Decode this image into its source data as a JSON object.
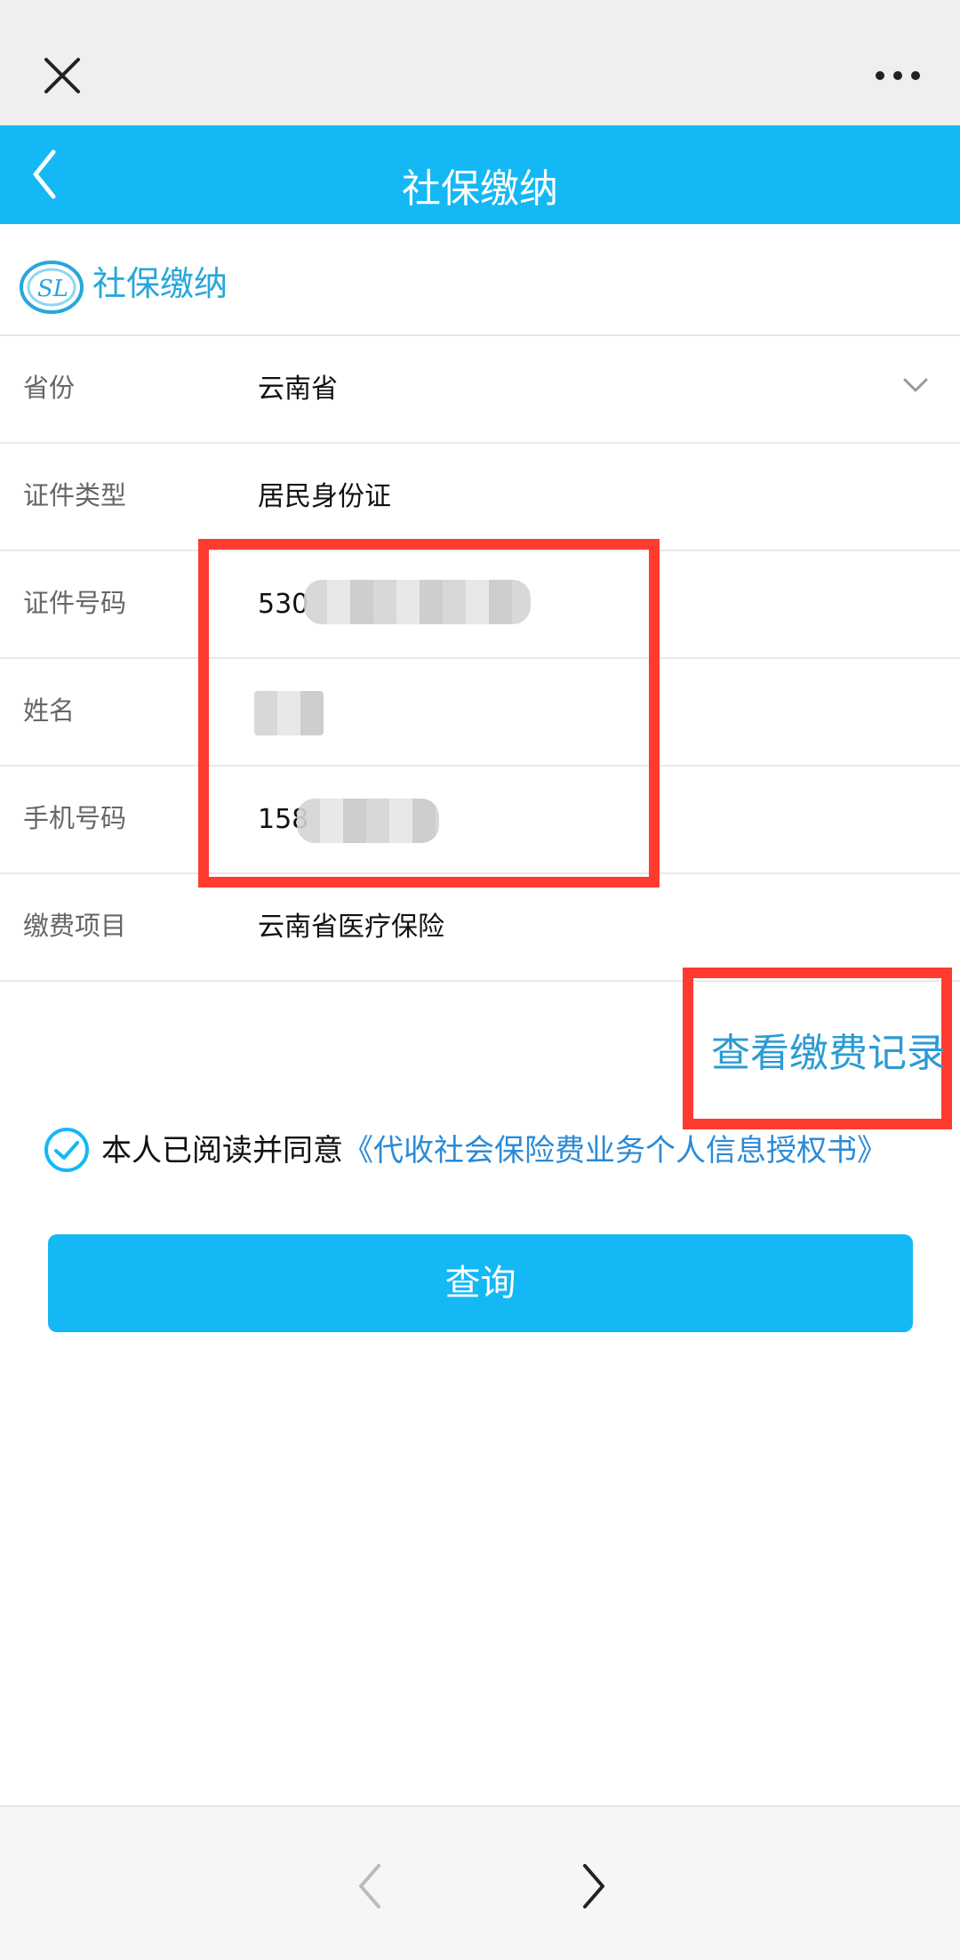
{
  "header": {
    "title": "社保缴纳"
  },
  "brand": {
    "logo_text": "SL",
    "name": "社保缴纳"
  },
  "form": {
    "rows": [
      {
        "label": "省份",
        "value": "云南省"
      },
      {
        "label": "证件类型",
        "value": "居民身份证"
      },
      {
        "label": "证件号码",
        "value": "530"
      },
      {
        "label": "姓名",
        "value": ""
      },
      {
        "label": "手机号码",
        "value": "158"
      },
      {
        "label": "缴费项目",
        "value": "云南省医疗保险"
      }
    ]
  },
  "actions": {
    "view_record": "查看缴费记录",
    "query": "查询"
  },
  "agreement": {
    "prefix": "本人已阅读并同意",
    "link": "《代收社会保险费业务个人信息授权书》",
    "checked": true
  },
  "colors": {
    "accent": "#14b8f4",
    "link": "#2b8ad6",
    "annotation": "#ff3b30"
  },
  "icons": {
    "close": "close-icon",
    "more": "more-icon",
    "back": "chevron-left-icon",
    "dropdown": "chevron-down-icon",
    "check": "check-circle-icon",
    "nav_back": "chevron-left-icon",
    "nav_forward": "chevron-right-icon"
  }
}
